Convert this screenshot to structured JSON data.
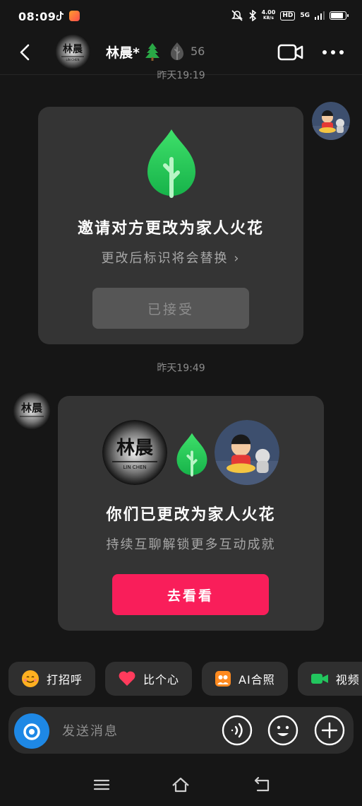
{
  "status_bar": {
    "time": "08:09",
    "net_speed_top": "4.00",
    "net_speed_bottom": "KB/s",
    "hd_label": "HD",
    "network_label": "5G",
    "battery_level": 0.9
  },
  "header": {
    "contact_name": "林晨*",
    "spark_count": "56",
    "icons": [
      "back-icon",
      "tree-icon",
      "flame-icon",
      "video-call-icon",
      "more-icon"
    ]
  },
  "messages": [
    {
      "timestamp": "昨天19:19",
      "title": "邀请对方更改为家人火花",
      "subtitle": "更改后标识将会替换",
      "button": "已接受"
    },
    {
      "timestamp": "昨天19:49",
      "title": "你们已更改为家人火花",
      "subtitle": "持续互聊解锁更多互动成就",
      "button": "去看看"
    }
  ],
  "avatar_text": {
    "name": "林晨",
    "sub": "LIN CHEN"
  },
  "quick_actions": [
    {
      "label": "打招呼",
      "icon": "wave-emoji-icon"
    },
    {
      "label": "比个心",
      "icon": "heart-icon"
    },
    {
      "label": "AI合照",
      "icon": "ai-photo-icon"
    },
    {
      "label": "视频",
      "icon": "video-icon"
    }
  ],
  "input": {
    "placeholder": "发送消息"
  },
  "colors": {
    "background": "#161616",
    "card": "#343434",
    "accent_pink": "#f91e5a",
    "spark_green": "#2ed158",
    "camera_blue": "#1e88e5"
  }
}
